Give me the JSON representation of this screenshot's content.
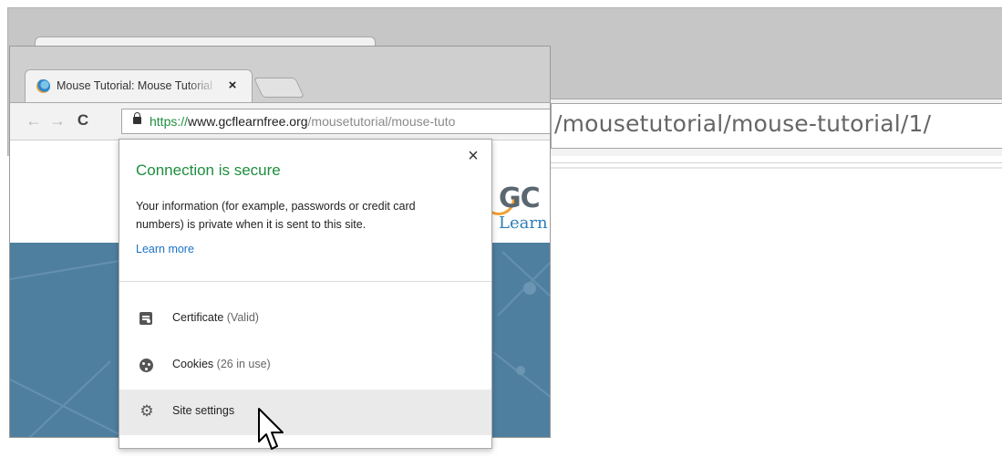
{
  "zoom_address": {
    "url_text": "/mousetutorial/mouse-tutorial/1/"
  },
  "tab": {
    "title": "Mouse Tutorial: Mouse Tutorial",
    "close_label": "×",
    "favicon": "gcf-globe-icon"
  },
  "nav": {
    "back_icon": "←",
    "forward_icon": "→",
    "reload_icon": "C"
  },
  "address_bar": {
    "scheme": "https://",
    "host": "www.gcflearnfree.org",
    "path": "/mousetutorial/mouse-tuto"
  },
  "page_logo": {
    "gc": "GC",
    "learn": "Learn"
  },
  "popup": {
    "close_label": "×",
    "title": "Connection is secure",
    "description": "Your information (for example, passwords or credit card numbers) is private when it is sent to this site.",
    "learn_more": "Learn more",
    "items": [
      {
        "label": "Certificate",
        "detail": "(Valid)",
        "icon": "certificate-icon"
      },
      {
        "label": "Cookies",
        "detail": "(26 in use)",
        "icon": "cookie-icon"
      },
      {
        "label": "Site settings",
        "detail": "",
        "icon": "gear-icon"
      }
    ]
  },
  "colors": {
    "secure_green": "#1e8e3e",
    "link_blue": "#1a73c8",
    "hero_blue": "#4f7f9f"
  }
}
